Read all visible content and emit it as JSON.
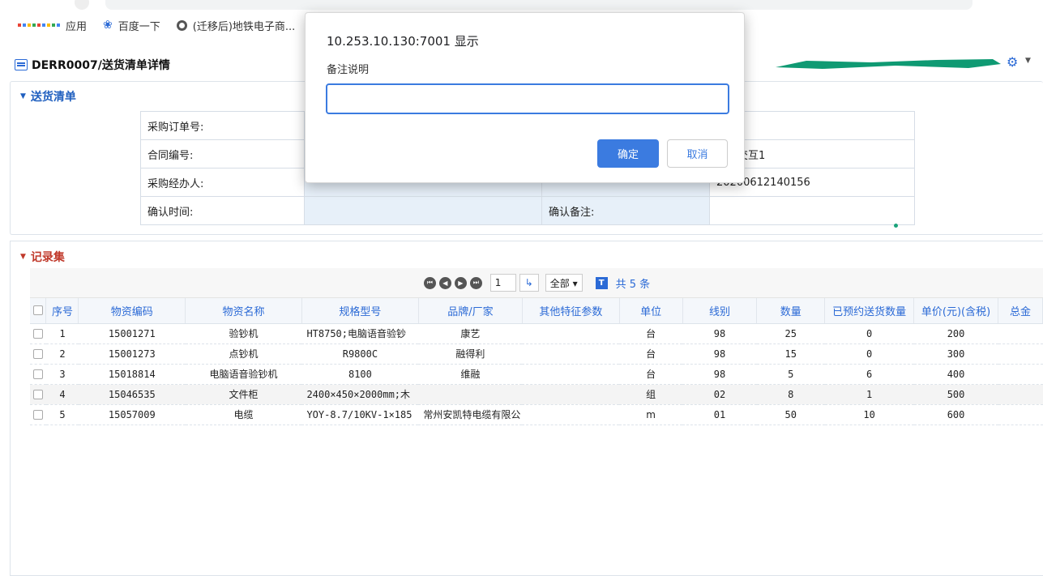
{
  "bookmarks": {
    "apps_label": "应用",
    "baidu_label": "百度一下",
    "site_label": "(迁移后)地铁电子商..."
  },
  "header": {
    "title": "DERR0007/送货清单详情"
  },
  "delivery_section": {
    "title": "送货清单",
    "rows": [
      {
        "label1": "采购订单号:",
        "value1": "",
        "label2": "",
        "value2": ""
      },
      {
        "label1": "合同编号:",
        "value1": "",
        "label2": "",
        "value2": "信息交互1"
      },
      {
        "label1": "采购经办人:",
        "value1": "",
        "label2": "",
        "value2": "20200612140156"
      },
      {
        "label1": "确认时间:",
        "value1": "",
        "label2": "确认备注:",
        "value2": ""
      }
    ]
  },
  "records_section": {
    "title": "记录集",
    "pager": {
      "page": "1",
      "page_size": "全部 ▾",
      "t_icon": "T",
      "total": "共 5 条"
    },
    "columns": [
      "序号",
      "物资编码",
      "物资名称",
      "规格型号",
      "品牌/厂家",
      "其他特征参数",
      "单位",
      "线别",
      "数量",
      "已预约送货数量",
      "单价(元)(含税)",
      "总金"
    ],
    "rows": [
      [
        "1",
        "15001271",
        "验钞机",
        "HT8750;电脑语音验钞",
        "康艺",
        "",
        "台",
        "98",
        "25",
        "0",
        "200"
      ],
      [
        "2",
        "15001273",
        "点钞机",
        "R9800C",
        "融得利",
        "",
        "台",
        "98",
        "15",
        "0",
        "300"
      ],
      [
        "3",
        "15018814",
        "电脑语音验钞机",
        "8100",
        "维融",
        "",
        "台",
        "98",
        "5",
        "6",
        "400"
      ],
      [
        "4",
        "15046535",
        "文件柜",
        "2400×450×2000mm;木",
        "",
        "",
        "组",
        "02",
        "8",
        "1",
        "500"
      ],
      [
        "5",
        "15057009",
        "电缆",
        "YOY-8.7/10KV-1×185",
        "常州安凯特电缆有限公",
        "",
        "m",
        "01",
        "50",
        "10",
        "600"
      ]
    ]
  },
  "dialog": {
    "origin": "10.253.10.130:7001 显示",
    "message": "备注说明",
    "input_value": "",
    "ok_label": "确定",
    "cancel_label": "取消"
  },
  "colors": {
    "accent": "#3b7be0",
    "section_blue": "#1f5fbf",
    "section_red": "#c0392b",
    "redaction": "#0f9a73"
  },
  "icons": [
    "apps-grid-icon",
    "baidu-paw-icon",
    "globe-icon",
    "doc-icon",
    "gear-icon",
    "checkbox-icon",
    "pager-first-icon",
    "pager-prev-icon",
    "pager-next-icon",
    "pager-last-icon",
    "go-icon"
  ]
}
